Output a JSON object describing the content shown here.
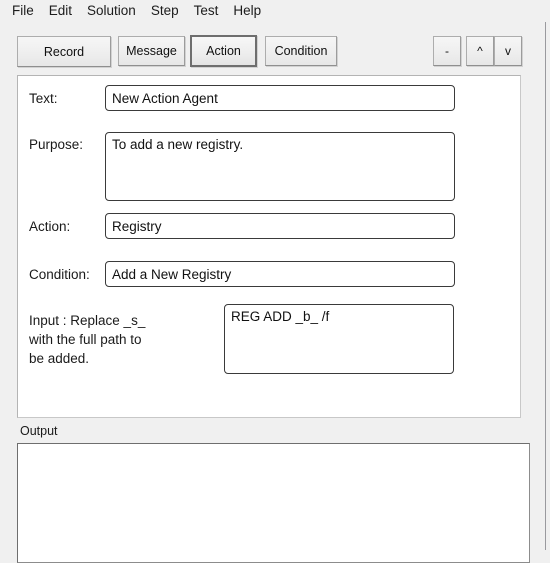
{
  "menubar": {
    "items": [
      {
        "label": "File"
      },
      {
        "label": "Edit"
      },
      {
        "label": "Solution"
      },
      {
        "label": "Step"
      },
      {
        "label": "Test"
      },
      {
        "label": "Help"
      }
    ]
  },
  "toolbar": {
    "record_label": "Record",
    "message_label": "Message",
    "action_label": "Action",
    "condition_label": "Condition",
    "minus_label": "-",
    "up_label": "^",
    "down_label": "v",
    "selected": "Action"
  },
  "form": {
    "text": {
      "label": "Text:",
      "value": "New Action Agent",
      "placeholder": ""
    },
    "purpose": {
      "label": "Purpose:",
      "value": "To add a new registry.",
      "placeholder": ""
    },
    "action": {
      "label": "Action:",
      "value": "Registry",
      "placeholder": ""
    },
    "condition": {
      "label": "Condition:",
      "value": "Add a New Registry",
      "placeholder": ""
    },
    "input": {
      "label": "Input : Replace _s_ with the full path to be added.",
      "value": "REG ADD _b_ /f",
      "placeholder": ""
    }
  },
  "output": {
    "label": "Output",
    "value": "",
    "placeholder": ""
  },
  "colors": {
    "window_background": "#f0f0f0",
    "panel_background": "#ffffff",
    "field_border": "#3a3a3a",
    "button_face": "#efefef",
    "selected_button_border": "#6e6e6e",
    "text": "#1a1a1a"
  }
}
